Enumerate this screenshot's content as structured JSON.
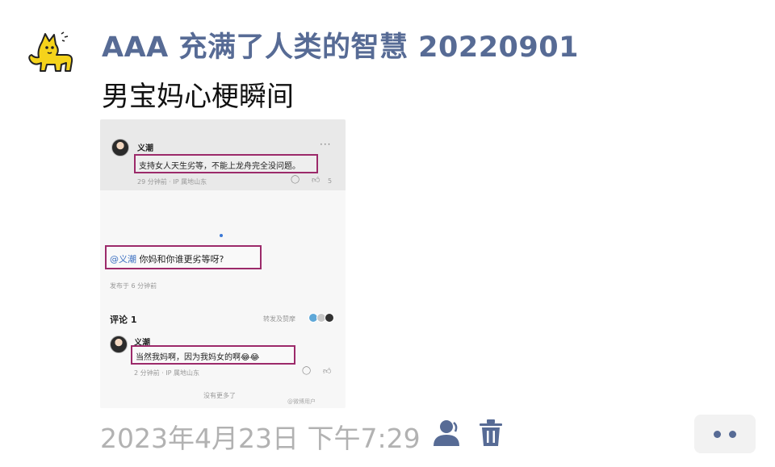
{
  "post": {
    "author": "AAA 充满了人类的智慧 20220901",
    "text": "男宝妈心梗瞬间",
    "timestamp": "2023年4月23日 下午7:29"
  },
  "screenshot": {
    "top_comment": {
      "user": "义潮",
      "text": "支持女人天生劣等，不能上龙舟完全没问题。",
      "meta": "29 分钟前 · IP 属地山东",
      "likes": "5"
    },
    "reply": {
      "mention": "@义潮",
      "text": " 你妈和你谁更劣等呀?",
      "meta": "发布于 6 分钟前"
    },
    "comments_header": "评论 1",
    "share_label": "转发及赞摩",
    "comment": {
      "user": "义潮",
      "text": "当然我妈啊，因为我妈女的啊😂😂",
      "meta": "2 分钟前 · IP 属地山东"
    },
    "footer": "没有更多了",
    "watermark": "@微博用户"
  },
  "icons": {
    "avatar": "yellow-cat-avatar",
    "user": "person-icon",
    "delete": "trash-icon",
    "more": "more-dots-icon"
  },
  "colors": {
    "name": "#576b95",
    "highlight_box": "#9c2a6a",
    "timestamp": "#b2b2b2"
  }
}
